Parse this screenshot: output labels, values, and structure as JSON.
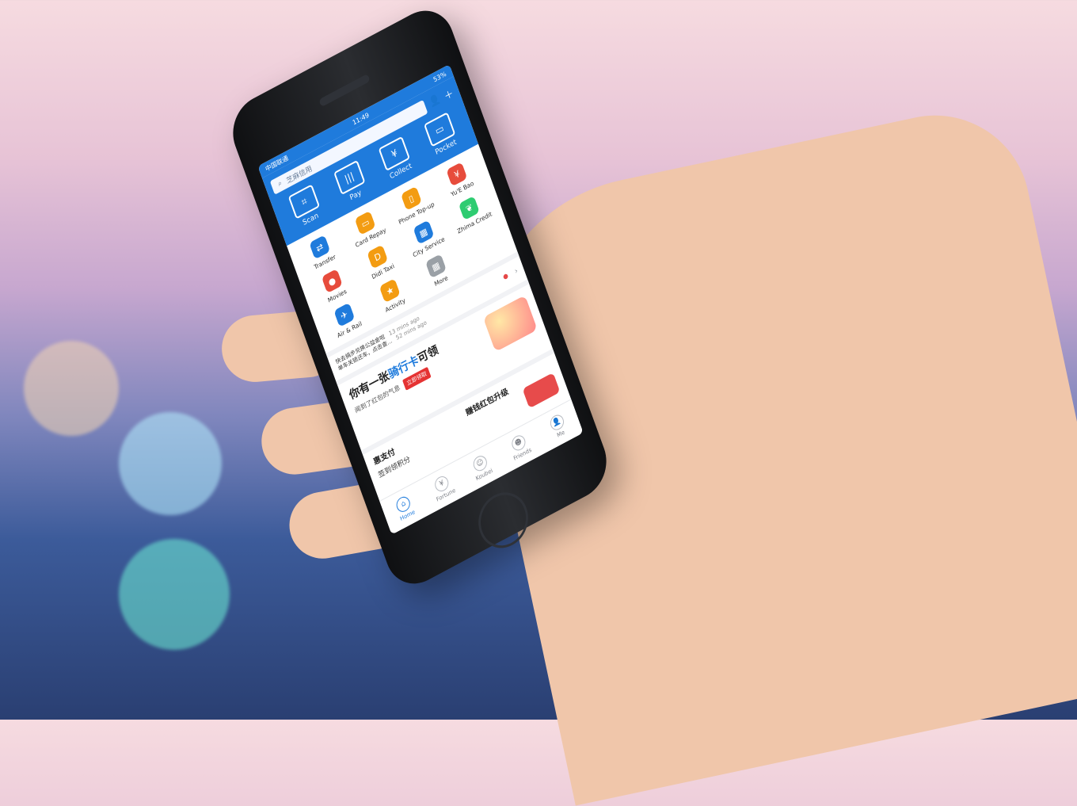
{
  "status": {
    "carrier": "中国联通",
    "time": "11:49",
    "battery": "53%"
  },
  "search": {
    "placeholder": "芝麻信用"
  },
  "quick_actions": [
    {
      "label": "Scan",
      "icon": "scan-icon"
    },
    {
      "label": "Pay",
      "icon": "barcode-icon"
    },
    {
      "label": "Collect",
      "icon": "collect-icon"
    },
    {
      "label": "Pocket",
      "icon": "pocket-icon"
    }
  ],
  "tools": [
    {
      "label": "Transfer",
      "icon": "transfer-icon",
      "color": "#1f7bdc"
    },
    {
      "label": "Card Repay",
      "icon": "card-icon",
      "color": "#f39c12"
    },
    {
      "label": "Phone Top-up",
      "icon": "phone-icon",
      "color": "#f39c12"
    },
    {
      "label": "Yu'E Bao",
      "icon": "yuebao-icon",
      "color": "#e74c3c"
    },
    {
      "label": "Movies",
      "icon": "movies-icon",
      "color": "#e74c3c"
    },
    {
      "label": "Didi Taxi",
      "icon": "taxi-icon",
      "color": "#f39c12"
    },
    {
      "label": "City Service",
      "icon": "city-icon",
      "color": "#1f7bdc"
    },
    {
      "label": "Zhima Credit",
      "icon": "leaf-icon",
      "color": "#2ecc71"
    },
    {
      "label": "Air & Rail",
      "icon": "air-rail-icon",
      "color": "#1f7bdc"
    },
    {
      "label": "Activity",
      "icon": "activity-icon",
      "color": "#f39c12"
    },
    {
      "label": "More",
      "icon": "more-icon",
      "color": "#9aa0a6"
    }
  ],
  "news": [
    {
      "text": "快去捐步兑换公益金啦",
      "time": "13 mins ago"
    },
    {
      "text": "单车关锁还车，点击查...",
      "time": "52 mins ago"
    }
  ],
  "banner": {
    "title_prefix": "你有一张",
    "title_highlight": "骑行卡",
    "title_suffix": "可领",
    "subtitle": "闻到了红包的气息",
    "cta": "立即领取"
  },
  "cards": [
    {
      "title": "惠支付",
      "subtitle": "签到领积分"
    },
    {
      "title": "赚钱红包升级",
      "subtitle": ""
    }
  ],
  "tabbar": [
    {
      "label": "Home",
      "icon": "home-icon",
      "active": true
    },
    {
      "label": "Fortune",
      "icon": "fortune-icon",
      "active": false
    },
    {
      "label": "Koubei",
      "icon": "koubei-icon",
      "active": false
    },
    {
      "label": "Friends",
      "icon": "friends-icon",
      "active": false
    },
    {
      "label": "Me",
      "icon": "me-icon",
      "active": false
    }
  ]
}
